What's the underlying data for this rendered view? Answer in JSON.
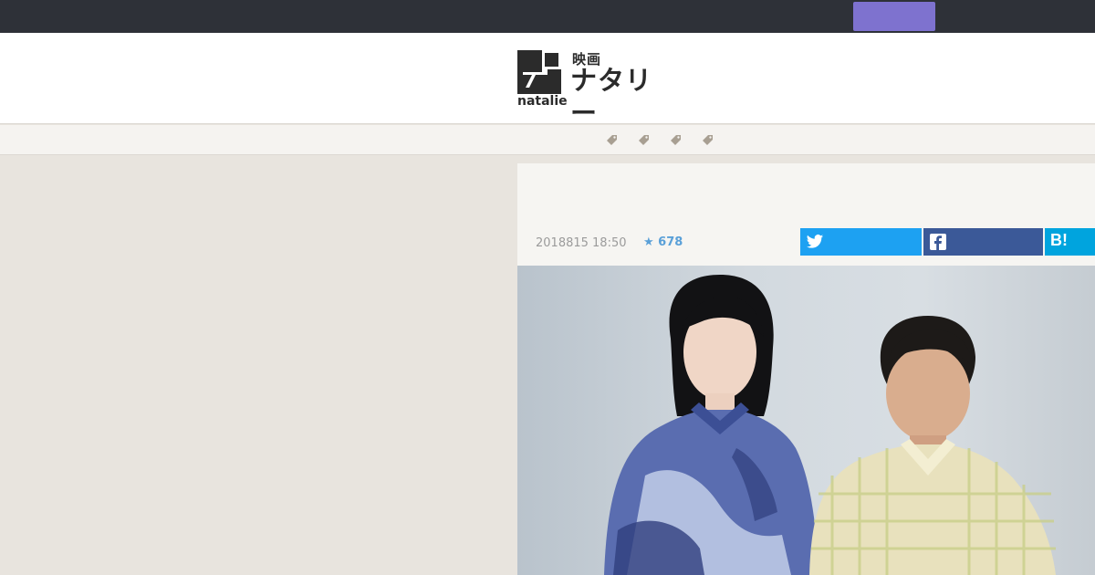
{
  "header": {
    "logo_sub": "映画",
    "logo_main": "ナタリー",
    "logo_word": "natalie"
  },
  "nav": {
    "tags": [
      {
        "icon": "tag-icon"
      },
      {
        "icon": "tag-icon"
      },
      {
        "icon": "tag-icon"
      },
      {
        "icon": "tag-icon"
      }
    ]
  },
  "article": {
    "date": "2018815 18:50",
    "stars": "★ 678",
    "share": {
      "twitter_icon": "twitter-icon",
      "facebook_icon": "facebook-icon",
      "hatena_label": "B!"
    },
    "photo": "photo-two-people"
  },
  "colors": {
    "topbar": "#2e3138",
    "login_button": "#7e72cf",
    "twitter": "#1da1f2",
    "facebook": "#3b5998",
    "hatena": "#00a4de",
    "star": "#5aa0d8"
  }
}
